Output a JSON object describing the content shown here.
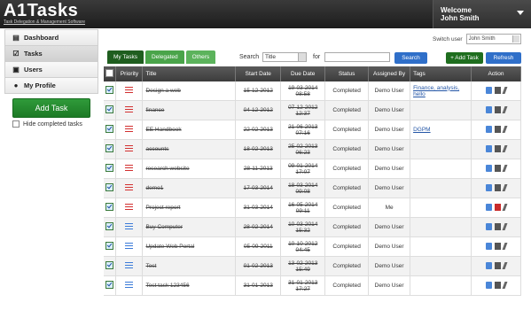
{
  "header": {
    "logo_name": "A1Tasks",
    "logo_tagline": "Task Delegation & Management Software",
    "welcome_label": "Welcome",
    "user_name": "John Smith"
  },
  "sidebar": {
    "items": [
      {
        "label": "Dashboard",
        "icon": "dashboard-icon"
      },
      {
        "label": "Tasks",
        "icon": "tasks-icon"
      },
      {
        "label": "Users",
        "icon": "users-icon"
      },
      {
        "label": "My Profile",
        "icon": "profile-icon"
      }
    ],
    "add_task_label": "Add Task",
    "hide_completed_label": "Hide completed tasks"
  },
  "switch_user": {
    "label": "Switch user",
    "value": "John Smith"
  },
  "toolbar": {
    "tabs": [
      "My Tasks",
      "Delegated",
      "Others"
    ],
    "search_label": "Search",
    "search_field": "Title",
    "for_label": "for",
    "search_button": "Search",
    "add_task_button": "+ Add Task",
    "refresh_button": "Refresh"
  },
  "table": {
    "columns": [
      "",
      "Priority",
      "Title",
      "Start Date",
      "Due Date",
      "Status",
      "Assigned By",
      "Tags",
      "Action"
    ],
    "rows": [
      {
        "priority": "high",
        "title": "Design a web",
        "start": "15-12-2012",
        "due": "19-03-2014 08:58",
        "status": "Completed",
        "assigned_by": "Demo User",
        "tags": "Finance, analysis, hello",
        "delete_highlight": false
      },
      {
        "priority": "high",
        "title": "finance",
        "start": "04-12-2012",
        "due": "07-12-2012 12:37",
        "status": "Completed",
        "assigned_by": "Demo User",
        "tags": "",
        "delete_highlight": false
      },
      {
        "priority": "high",
        "title": "EE Handbook",
        "start": "22-02-2013",
        "due": "21-06-2013 07:16",
        "status": "Completed",
        "assigned_by": "Demo User",
        "tags": "DGPM",
        "delete_highlight": false
      },
      {
        "priority": "high",
        "title": "accounts",
        "start": "18-02-2013",
        "due": "25-02-2013 06:23",
        "status": "Completed",
        "assigned_by": "Demo User",
        "tags": "",
        "delete_highlight": false
      },
      {
        "priority": "high",
        "title": "research website",
        "start": "28-11-2013",
        "due": "09-01-2014 17:07",
        "status": "Completed",
        "assigned_by": "Demo User",
        "tags": "",
        "delete_highlight": false
      },
      {
        "priority": "high",
        "title": "demo1",
        "start": "17-03-2014",
        "due": "18-03-2014 09:08",
        "status": "Completed",
        "assigned_by": "Demo User",
        "tags": "",
        "delete_highlight": false
      },
      {
        "priority": "high",
        "title": "Project report",
        "start": "31-03-2014",
        "due": "16-05-2014 09:11",
        "status": "Completed",
        "assigned_by": "Me",
        "tags": "",
        "delete_highlight": true
      },
      {
        "priority": "low",
        "title": "Buy Computer",
        "start": "28-02-2014",
        "due": "10-03-2014 15:32",
        "status": "Completed",
        "assigned_by": "Demo User",
        "tags": "",
        "delete_highlight": false
      },
      {
        "priority": "low",
        "title": "Update Web Portal",
        "start": "05-09-2011",
        "due": "10-10-2012 04:45",
        "status": "Completed",
        "assigned_by": "Demo User",
        "tags": "",
        "delete_highlight": false
      },
      {
        "priority": "low",
        "title": "Test",
        "start": "01-02-2013",
        "due": "13-02-2013 15:49",
        "status": "Completed",
        "assigned_by": "Demo User",
        "tags": "",
        "delete_highlight": false
      },
      {
        "priority": "low",
        "title": "Test task 123456",
        "start": "31-01-2013",
        "due": "31-01-2013 17:27",
        "status": "Completed",
        "assigned_by": "Demo User",
        "tags": "",
        "delete_highlight": false
      }
    ]
  },
  "colors": {
    "priority_high": "#d23030",
    "priority_low": "#3a7ad8",
    "accent_green": "#1f6e1f",
    "accent_blue": "#2f6fc9"
  }
}
